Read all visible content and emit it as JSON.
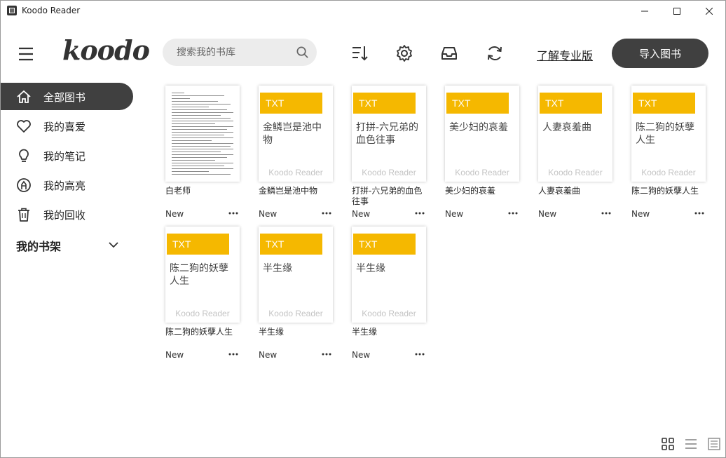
{
  "window": {
    "title": "Koodo Reader"
  },
  "header": {
    "logo": "koodo",
    "search_placeholder": "搜索我的书库",
    "pro_link": "了解专业版",
    "import_button": "导入图书"
  },
  "sidebar": {
    "items": [
      {
        "label": "全部图书",
        "icon": "home-icon",
        "active": true
      },
      {
        "label": "我的喜爱",
        "icon": "heart-icon",
        "active": false
      },
      {
        "label": "我的笔记",
        "icon": "bulb-icon",
        "active": false
      },
      {
        "label": "我的高亮",
        "icon": "highlighter-icon",
        "active": false
      },
      {
        "label": "我的回收",
        "icon": "trash-icon",
        "active": false
      }
    ],
    "shelf_title": "我的书架"
  },
  "books": [
    {
      "name": "白老师",
      "badge": "",
      "cover_title": "",
      "brand": "",
      "status": "New"
    },
    {
      "name": "金鳞岂是池中物",
      "badge": "TXT",
      "cover_title": "金鳞岂是池中物",
      "brand": "Koodo Reader",
      "status": "New"
    },
    {
      "name": "打拼-六兄弟的血色往事",
      "badge": "TXT",
      "cover_title": "打拼-六兄弟的血色往事",
      "brand": "Koodo Reader",
      "status": "New"
    },
    {
      "name": "美少妇的哀羞",
      "badge": "TXT",
      "cover_title": "美少妇的哀羞",
      "brand": "Koodo Reader",
      "status": "New"
    },
    {
      "name": "人妻哀羞曲",
      "badge": "TXT",
      "cover_title": "人妻哀羞曲",
      "brand": "Koodo Reader",
      "status": "New"
    },
    {
      "name": "陈二狗的妖孽人生",
      "badge": "TXT",
      "cover_title": "陈二狗的妖孽人生",
      "brand": "Koodo Reader",
      "status": "New"
    },
    {
      "name": "陈二狗的妖孽人生",
      "badge": "TXT",
      "cover_title": "陈二狗的妖孽人生",
      "brand": "Koodo Reader",
      "status": "New"
    },
    {
      "name": "半生缘",
      "badge": "TXT",
      "cover_title": "半生缘",
      "brand": "Koodo Reader",
      "status": "New"
    },
    {
      "name": "半生缘",
      "badge": "TXT",
      "cover_title": "半生缘",
      "brand": "Koodo Reader",
      "status": "New"
    }
  ],
  "colors": {
    "accent_dark": "#404040",
    "txt_badge": "#f5b800",
    "search_bg": "#ececec"
  }
}
